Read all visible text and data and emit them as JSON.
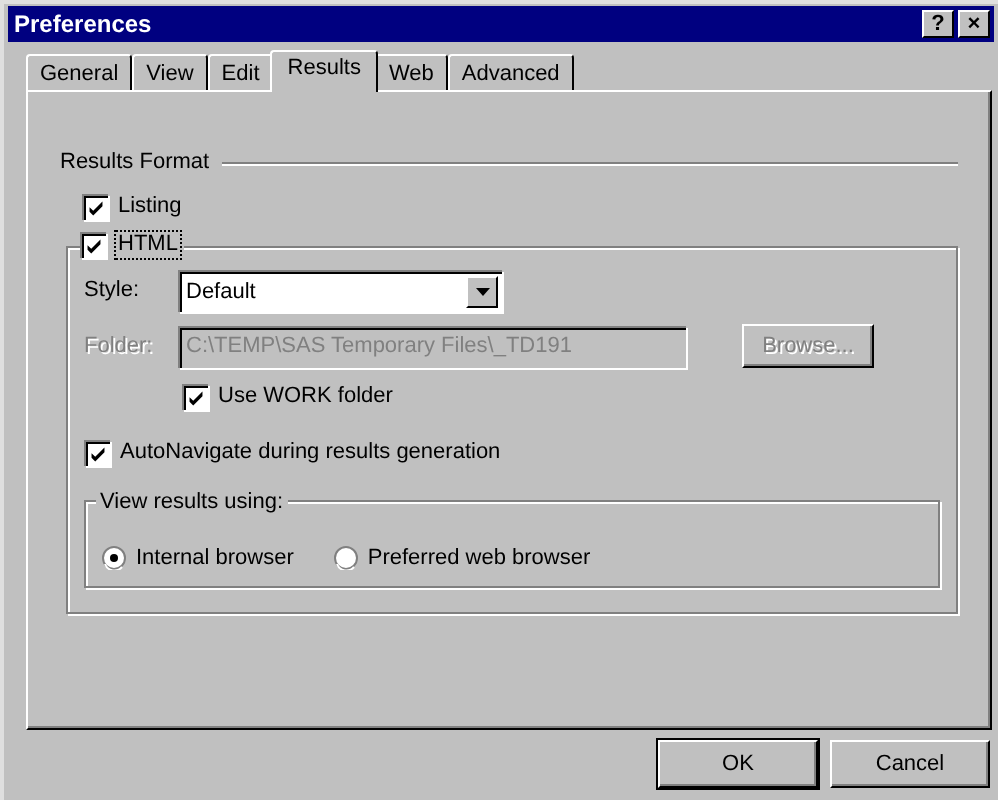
{
  "window": {
    "title": "Preferences",
    "title_buttons": [
      "?",
      "×"
    ]
  },
  "tabs": [
    {
      "label": "General",
      "selected": false
    },
    {
      "label": "View",
      "selected": false
    },
    {
      "label": "Edit",
      "selected": false
    },
    {
      "label": "Results",
      "selected": true
    },
    {
      "label": "Web",
      "selected": false
    },
    {
      "label": "Advanced",
      "selected": false
    }
  ],
  "results_format": {
    "label": "Results Format",
    "listing": {
      "label": "Listing",
      "checked": true
    },
    "html": {
      "label": "HTML",
      "checked": true,
      "focused": true
    },
    "style": {
      "label": "Style:",
      "value": "Default"
    },
    "folder": {
      "label": "Folder:",
      "value": "C:\\TEMP\\SAS Temporary Files\\_TD191",
      "disabled": true
    },
    "browse": {
      "label": "Browse...",
      "disabled": true
    },
    "use_work_folder": {
      "label": "Use WORK folder",
      "checked": true
    },
    "autonavigate": {
      "label": "AutoNavigate during results generation",
      "checked": true
    },
    "view_results": {
      "label": "View results using:",
      "options": [
        {
          "label": "Internal browser",
          "selected": true
        },
        {
          "label": "Preferred web browser",
          "selected": false
        }
      ]
    }
  },
  "buttons": [
    {
      "label": "OK",
      "default": true
    },
    {
      "label": "Cancel",
      "default": false
    }
  ]
}
